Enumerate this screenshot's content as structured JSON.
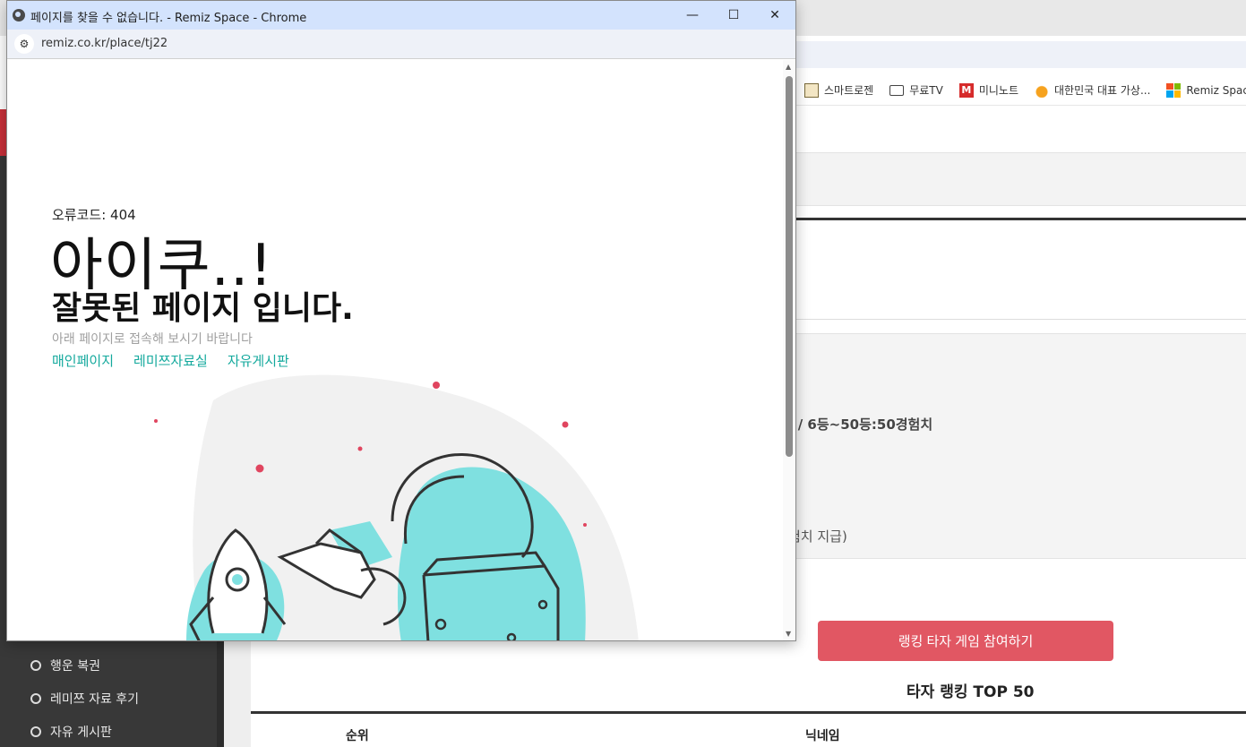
{
  "background_window": {
    "bookmarks": [
      {
        "label": "스마트로젠",
        "icon": "image-icon"
      },
      {
        "label": "무료TV",
        "icon": "folder-icon"
      },
      {
        "label": "미니노트",
        "icon": "m-logo-icon"
      },
      {
        "label": "대한민국 대표 가상...",
        "icon": "flame-icon"
      },
      {
        "label": "Remiz Space",
        "icon": "microsoft-logo-icon"
      }
    ],
    "sidebar_items": [
      "행운 복권",
      "레미쯔 자료 후기",
      "자유 게시판"
    ],
    "reward_text": "| / 6등~50등:50경험치",
    "reward_note": "험치 지급)",
    "ranking_button": "랭킹 타자 게임 참여하기",
    "ranking_title": "타자 랭킹 TOP 50",
    "table_headers": [
      "순위",
      "닉네임"
    ],
    "colors": {
      "sidebar": "#383838",
      "button": "#e15763",
      "accent_red": "#c8303a"
    }
  },
  "popup": {
    "window_title": "페이지를 찾을 수 없습니다. - Remiz Space - Chrome",
    "url": "remiz.co.kr/place/tj22",
    "controls": {
      "minimize": "—",
      "maximize": "☐",
      "close": "✕"
    },
    "error_code": "오류코드: 404",
    "headline": "아이쿠..!",
    "subheadline": "잘못된 페이지 입니다.",
    "hint": "아래 페이지로 접속해 보시기 바랍니다",
    "links": [
      "매인페이지",
      "레미쯔자료실",
      "자유게시판"
    ],
    "colors": {
      "titlebar": "#d3e3fd",
      "link": "#14a99d",
      "illustration_accent": "#7fe0e0",
      "dots": "#e0455f"
    }
  }
}
